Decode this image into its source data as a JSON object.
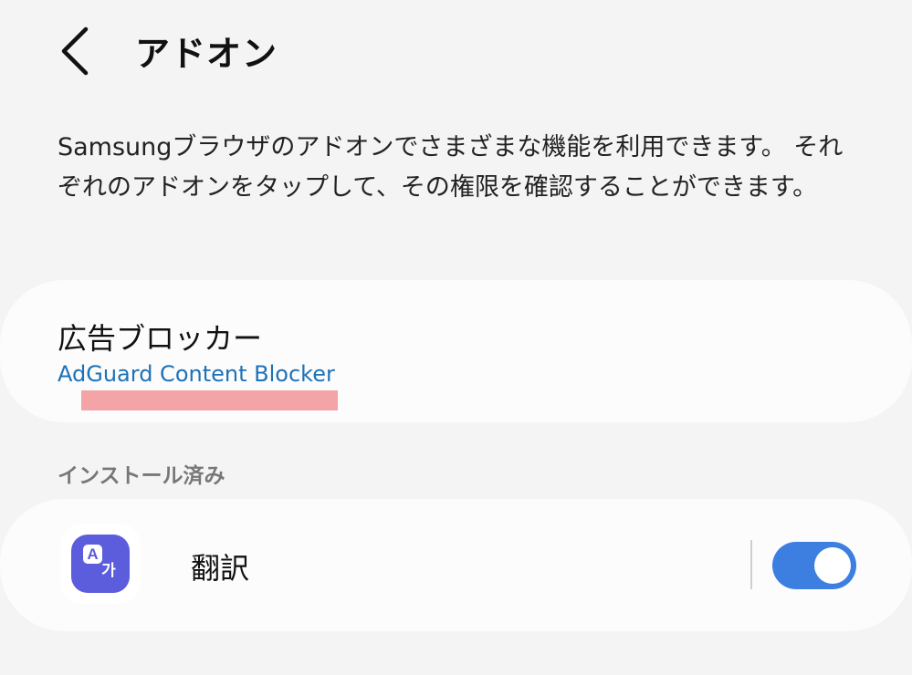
{
  "header": {
    "title": "アドオン",
    "back_icon": "chevron-left-icon"
  },
  "description": "Samsungブラウザのアドオンでさまざまな機能を利用できます。 それぞれのアドオンをタップして、その権限を確認することができます。",
  "ad_blocker": {
    "title": "広告ブロッカー",
    "subtitle": "AdGuard Content Blocker",
    "subtitle_color": "#1d72b8",
    "highlight_color": "#f4a3a6"
  },
  "installed": {
    "section_label": "インストール済み",
    "items": [
      {
        "name": "翻訳",
        "icon": "translate-icon",
        "icon_glyph_a": "A",
        "icon_glyph_k": "가",
        "icon_color": "#5b5ddc",
        "enabled": true,
        "toggle_color": "#3d7fe0"
      }
    ]
  }
}
